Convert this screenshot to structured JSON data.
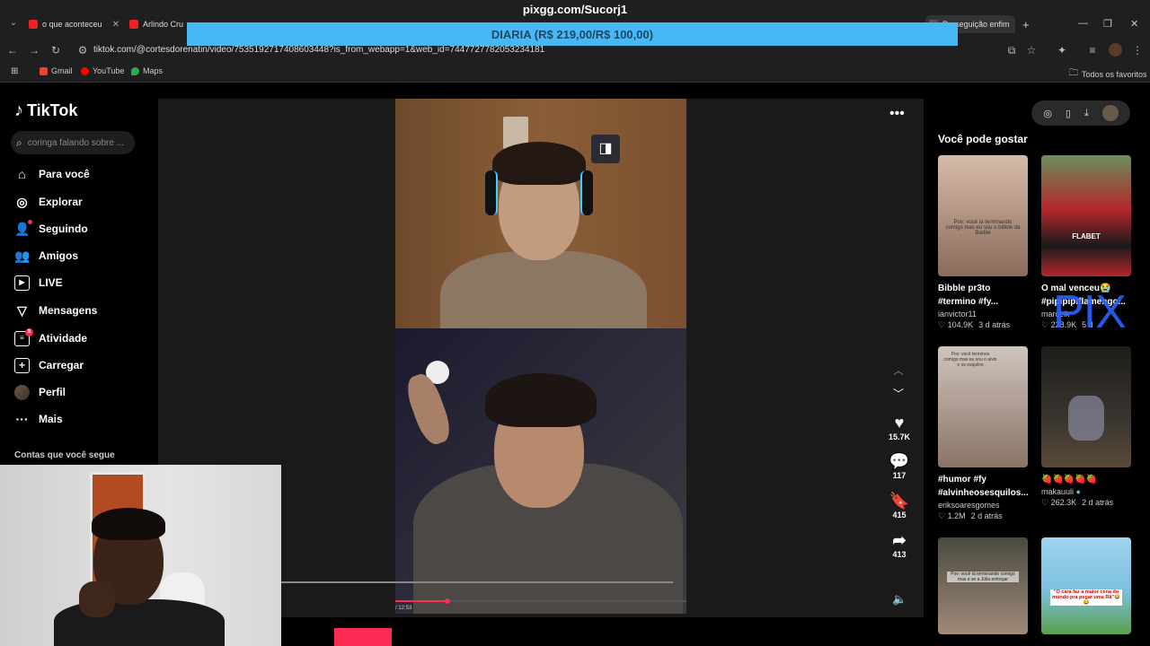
{
  "browser": {
    "tabs": [
      {
        "label": "o que aconteceu",
        "color": "#e22222"
      },
      {
        "label": "Arlindo Cruz -",
        "color": "#e22222"
      },
      {
        "label": "Perseguição enfim",
        "color": "#aaaaaa"
      }
    ],
    "overlay_title": "pixgg.com/Sucorj1",
    "promo_banner": "DIARIA (R$ 219,00/R$ 100,00)",
    "url": "tiktok.com/@cortesdorenatin/video/7535192717408603448?is_from_webapp=1&web_id=7447727782053234181",
    "bookmarks": [
      {
        "label": "Gmail",
        "color": "#ea4335"
      },
      {
        "label": "YouTube",
        "color": "#ff0000"
      },
      {
        "label": "Maps",
        "color": "#34a853"
      }
    ],
    "all_favorites": "Todos os favoritos"
  },
  "sidebar": {
    "logo": "TikTok",
    "search_placeholder": "coringa falando sobre ...",
    "items": [
      {
        "label": "Para você",
        "icon": "home-icon"
      },
      {
        "label": "Explorar",
        "icon": "compass-icon"
      },
      {
        "label": "Seguindo",
        "icon": "following-icon"
      },
      {
        "label": "Amigos",
        "icon": "friends-icon"
      },
      {
        "label": "LIVE",
        "icon": "live-icon"
      },
      {
        "label": "Mensagens",
        "icon": "messages-icon"
      },
      {
        "label": "Atividade",
        "icon": "activity-icon",
        "badge": "8"
      },
      {
        "label": "Carregar",
        "icon": "upload-icon"
      },
      {
        "label": "Perfil",
        "icon": "avatar"
      },
      {
        "label": "Mais",
        "icon": "more-icon"
      }
    ],
    "following_header": "Contas que você segue"
  },
  "video": {
    "likes": "15.7K",
    "comments": "117",
    "saves": "415",
    "shares": "413",
    "time": "/ 12:53",
    "progress_fraction": 0.18
  },
  "recommendations": {
    "header": "Você pode gostar",
    "cards": [
      {
        "title": "Bibble pr3to #termino #fy...",
        "author": "ianvictor11",
        "likes": "104.9K",
        "age": "3 d atrás",
        "overlay": "Pov: você tá terminando comigo mas eu sou o bibble da Barbie",
        "bg": "#c8a898"
      },
      {
        "title": "O mal venceu😭 #pipipipiflamengo...",
        "author": "marcelk",
        "likes": "228.9K",
        "age": "5 d",
        "overlay": "FLABET",
        "bg": "#b4262c"
      },
      {
        "title": "#humor #fy #alvinheosesquilos...",
        "author": "eriksoaresgomes",
        "likes": "1.2M",
        "age": "2 d atrás",
        "overlay": "Pov: você terminou comigo mas eu sou o alvin e os esquilos",
        "bg": "#9a8a80"
      },
      {
        "title": "🍓🍓🍓🍓🍓",
        "author": "makauuli",
        "likes": "262.3K",
        "age": "2 d atrás",
        "overlay": "",
        "bg": "#2c2a26"
      },
      {
        "title": "",
        "author": "",
        "likes": "",
        "age": "",
        "overlay": "Pov: você tá terminando comigo mas e se a Júlia entregar",
        "bg": "#6e6860"
      },
      {
        "title": "",
        "author": "",
        "likes": "",
        "age": "",
        "overlay": "\"O cara faz a maior cena do mundo pra pegar uma Rã\"😂😂",
        "bg": "#7cc0e0"
      }
    ]
  },
  "watermark": "PIX"
}
